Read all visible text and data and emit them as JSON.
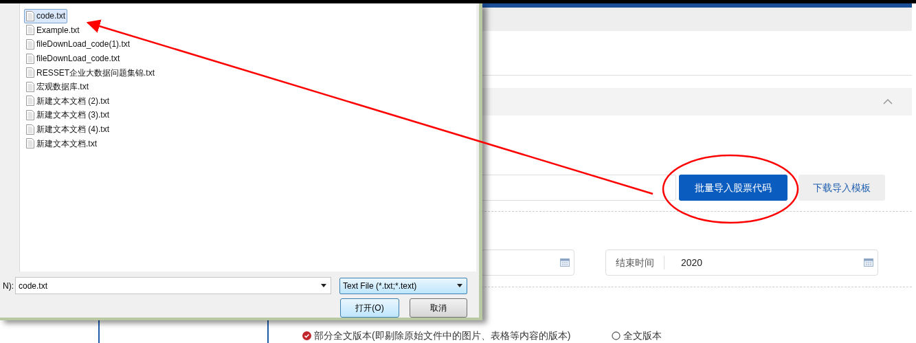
{
  "file_dialog": {
    "files": [
      {
        "name": "code.txt",
        "selected": true
      },
      {
        "name": "Example.txt",
        "selected": false
      },
      {
        "name": "fileDownLoad_code(1).txt",
        "selected": false
      },
      {
        "name": "fileDownLoad_code.txt",
        "selected": false
      },
      {
        "name": "RESSET企业大数据问题集锦.txt",
        "selected": false
      },
      {
        "name": "宏观数据库.txt",
        "selected": false
      },
      {
        "name": "新建文本文档 (2).txt",
        "selected": false
      },
      {
        "name": "新建文本文档 (3).txt",
        "selected": false
      },
      {
        "name": "新建文本文档 (4).txt",
        "selected": false
      },
      {
        "name": "新建文本文档.txt",
        "selected": false
      }
    ],
    "filename_label": "N):",
    "filename_value": "code.txt",
    "file_type": "Text File (*.txt;*.text)",
    "open_button": "打开(O)",
    "cancel_button": "取消"
  },
  "page": {
    "import_button": "批量导入股票代码",
    "template_button": "下载导入模板",
    "end_date": {
      "label": "结束时间",
      "value": "2020"
    },
    "versions": [
      {
        "label": "部分全文版本(即剔除原始文件中的图片、表格等内容的版本)",
        "selected": true
      },
      {
        "label": "全文版本",
        "selected": false
      }
    ]
  }
}
